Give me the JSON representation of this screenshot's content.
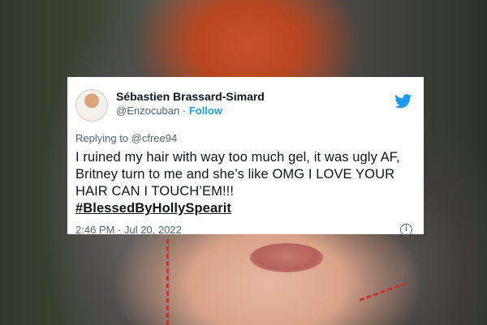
{
  "tweet": {
    "author_name": "Sébastien Brassard-Simard",
    "handle": "@Enzocuban",
    "separator": " · ",
    "follow_label": "Follow",
    "reply_prefix": "Replying to ",
    "reply_to": "@cfree94",
    "body": "I ruined my hair with way too much gel, it was ugly AF, Britney turn to me and she’s like OMG I LOVE YOUR HAIR CAN I TOUCH’EM!!!",
    "hashtag": "#BlessedByHollySpearit",
    "timestamp": "2:46 PM · Jul 20, 2022",
    "info_glyph": "i"
  },
  "icons": {
    "brand": "twitter-bird-icon",
    "info": "info-icon"
  },
  "colors": {
    "twitter_blue": "#1d9bf0",
    "text": "#0f1419",
    "muted": "#536471"
  }
}
